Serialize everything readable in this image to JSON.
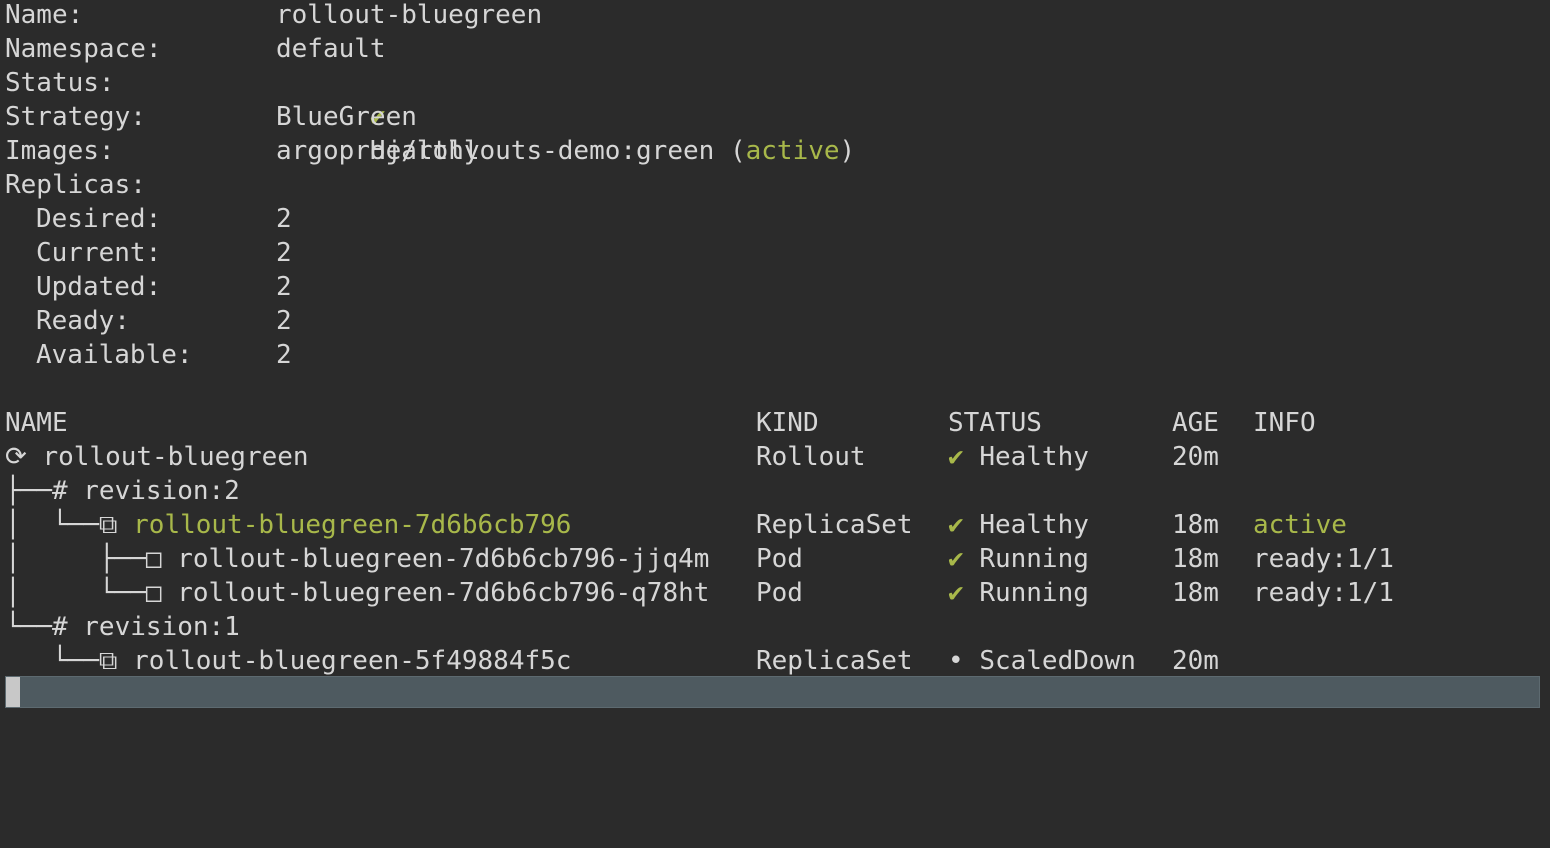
{
  "summary": {
    "name_label": "Name:",
    "name_value": "rollout-bluegreen",
    "namespace_label": "Namespace:",
    "namespace_value": "default",
    "status_label": "Status:",
    "status_icon": "✔",
    "status_value": "Healthy",
    "strategy_label": "Strategy:",
    "strategy_value": "BlueGreen",
    "images_label": "Images:",
    "images_value": "argoproj/rollouts-demo:green (",
    "images_tag": "active",
    "images_close": ")",
    "replicas_label": "Replicas:",
    "desired_label": "Desired:",
    "desired_value": "2",
    "current_label": "Current:",
    "current_value": "2",
    "updated_label": "Updated:",
    "updated_value": "2",
    "ready_label": "Ready:",
    "ready_value": "2",
    "available_label": "Available:",
    "available_value": "2"
  },
  "table": {
    "headers": {
      "name": "NAME",
      "kind": "KIND",
      "status": "STATUS",
      "age": "AGE",
      "info": "INFO"
    },
    "rows": [
      {
        "tree": "⟳ ",
        "name": "rollout-bluegreen",
        "kind": "Rollout",
        "status_icon": "✔",
        "status": "Healthy",
        "age": "20m",
        "info": ""
      },
      {
        "tree": "├──# ",
        "name": "revision:2",
        "kind": "",
        "status_icon": "",
        "status": "",
        "age": "",
        "info": ""
      },
      {
        "tree": "│  └──⧉ ",
        "name": "rollout-bluegreen-7d6b6cb796",
        "kind": "ReplicaSet",
        "status_icon": "✔",
        "status": "Healthy",
        "age": "18m",
        "info": "active"
      },
      {
        "tree": "│     ├──□ ",
        "name": "rollout-bluegreen-7d6b6cb796-jjq4m",
        "kind": "Pod",
        "status_icon": "✔",
        "status": "Running",
        "age": "18m",
        "info": "ready:1/1"
      },
      {
        "tree": "│     └──□ ",
        "name": "rollout-bluegreen-7d6b6cb796-q78ht",
        "kind": "Pod",
        "status_icon": "✔",
        "status": "Running",
        "age": "18m",
        "info": "ready:1/1"
      },
      {
        "tree": "└──# ",
        "name": "revision:1",
        "kind": "",
        "status_icon": "",
        "status": "",
        "age": "",
        "info": ""
      },
      {
        "tree": "   └──⧉ ",
        "name": "rollout-bluegreen-5f49884f5c",
        "kind": "ReplicaSet",
        "status_icon": "•",
        "status": "ScaledDown",
        "age": "20m",
        "info": ""
      }
    ]
  },
  "colors": {
    "background": "#2b2b2b",
    "text": "#d6d6d6",
    "accent_green": "#a8b84a",
    "statusbar": "#4e5a60"
  }
}
